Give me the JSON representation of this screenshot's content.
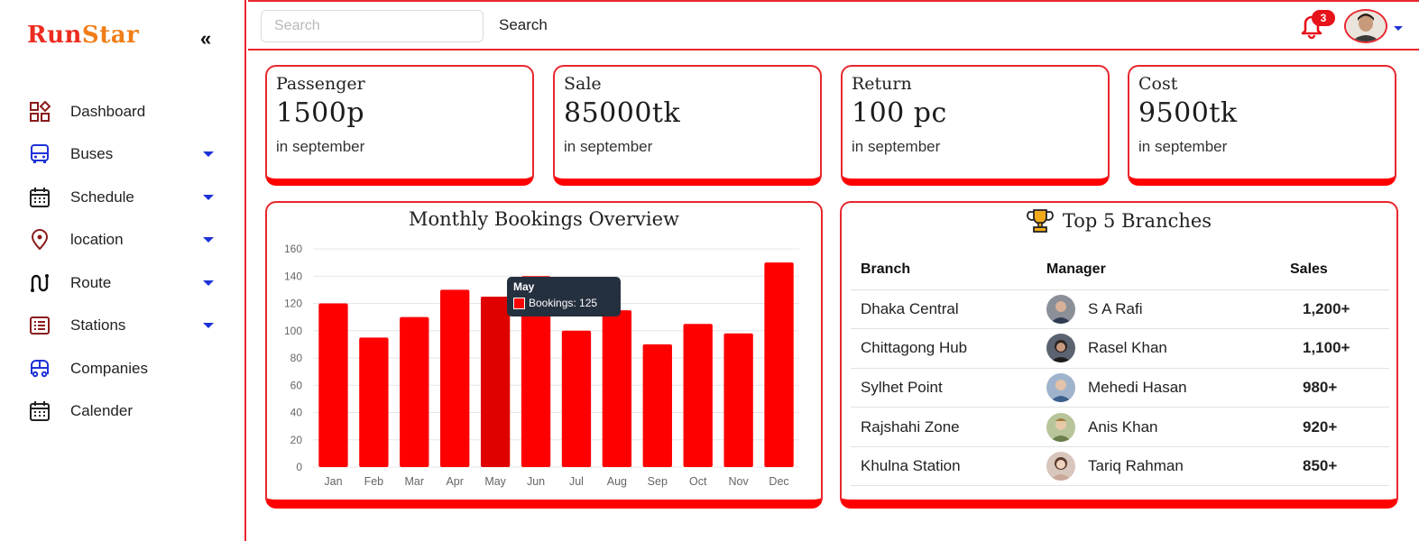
{
  "brand": {
    "part1": "Run",
    "part2": "Star"
  },
  "sidebar": {
    "collapse_label": "«",
    "items": [
      {
        "label": "Dashboard",
        "icon": "dashboard-icon",
        "has_caret": false
      },
      {
        "label": "Buses",
        "icon": "bus-icon",
        "has_caret": true
      },
      {
        "label": "Schedule",
        "icon": "calendar-icon",
        "has_caret": true
      },
      {
        "label": "location",
        "icon": "location-pin-icon",
        "has_caret": true
      },
      {
        "label": "Route",
        "icon": "route-icon",
        "has_caret": true
      },
      {
        "label": "Stations",
        "icon": "list-icon",
        "has_caret": true
      },
      {
        "label": "Companies",
        "icon": "bus-company-icon",
        "has_caret": false
      },
      {
        "label": "Calender",
        "icon": "calendar-icon",
        "has_caret": false
      }
    ]
  },
  "topbar": {
    "search_placeholder": "Search",
    "search_button": "Search",
    "notification_count": "3"
  },
  "stats": [
    {
      "title": "Passenger",
      "value": "1500p",
      "sub": "in september"
    },
    {
      "title": "Sale",
      "value": "85000tk",
      "sub": "in september"
    },
    {
      "title": "Return",
      "value": "100 pc",
      "sub": "in september"
    },
    {
      "title": "Cost",
      "value": "9500tk",
      "sub": "in september"
    }
  ],
  "chart_data": {
    "type": "bar",
    "title": "Monthly Bookings Overview",
    "categories": [
      "Jan",
      "Feb",
      "Mar",
      "Apr",
      "May",
      "Jun",
      "Jul",
      "Aug",
      "Sep",
      "Oct",
      "Nov",
      "Dec"
    ],
    "series": [
      {
        "name": "Bookings",
        "values": [
          120,
          95,
          110,
          130,
          125,
          140,
          100,
          115,
          90,
          105,
          98,
          150
        ]
      }
    ],
    "ylim": [
      0,
      160
    ],
    "yticks": [
      0,
      20,
      40,
      60,
      80,
      100,
      120,
      140,
      160
    ],
    "grid": true,
    "color": "#ff0000",
    "highlight_color": "#e00000",
    "tooltip": {
      "title": "May",
      "label": "Bookings: 125"
    }
  },
  "branches": {
    "title": "Top 5 Branches",
    "headers": {
      "branch": "Branch",
      "manager": "Manager",
      "sales": "Sales"
    },
    "rows": [
      {
        "branch": "Dhaka Central",
        "manager": "S A Rafi",
        "sales": "1,200+"
      },
      {
        "branch": "Chittagong Hub",
        "manager": "Rasel Khan",
        "sales": "1,100+"
      },
      {
        "branch": "Sylhet Point",
        "manager": "Mehedi Hasan",
        "sales": "980+"
      },
      {
        "branch": "Rajshahi Zone",
        "manager": "Anis Khan",
        "sales": "920+"
      },
      {
        "branch": "Khulna Station",
        "manager": "Tariq Rahman",
        "sales": "850+"
      }
    ]
  },
  "colors": {
    "accent": "#e8262e",
    "bar": "#ff0000",
    "caret": "#1d32d6"
  }
}
